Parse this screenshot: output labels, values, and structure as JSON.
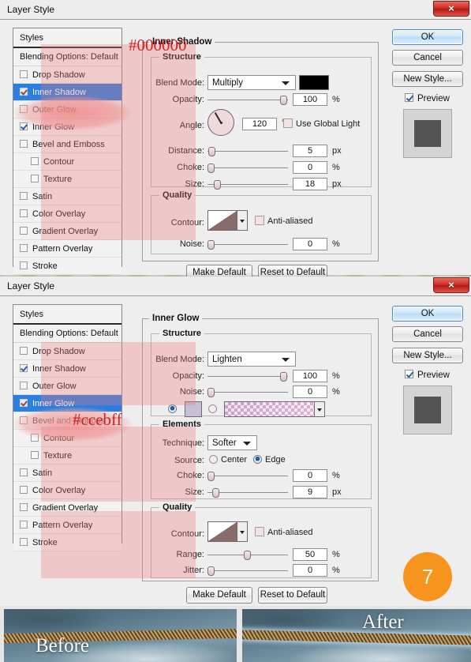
{
  "background": {
    "color": "#c3cdb4"
  },
  "dialogs": [
    {
      "title": "Layer Style",
      "close_label": "×",
      "styles_header": "Styles",
      "blending_options": "Blending Options: Default",
      "style_items": [
        {
          "label": "Drop Shadow",
          "checked": false,
          "indent": false,
          "selected": false
        },
        {
          "label": "Inner Shadow",
          "checked": true,
          "indent": false,
          "selected": true
        },
        {
          "label": "Outer Glow",
          "checked": false,
          "indent": false,
          "selected": false
        },
        {
          "label": "Inner Glow",
          "checked": true,
          "indent": false,
          "selected": false
        },
        {
          "label": "Bevel and Emboss",
          "checked": false,
          "indent": false,
          "selected": false
        },
        {
          "label": "Contour",
          "checked": false,
          "indent": true,
          "selected": false
        },
        {
          "label": "Texture",
          "checked": false,
          "indent": true,
          "selected": false
        },
        {
          "label": "Satin",
          "checked": false,
          "indent": false,
          "selected": false
        },
        {
          "label": "Color Overlay",
          "checked": false,
          "indent": false,
          "selected": false
        },
        {
          "label": "Gradient Overlay",
          "checked": false,
          "indent": false,
          "selected": false
        },
        {
          "label": "Pattern Overlay",
          "checked": false,
          "indent": false,
          "selected": false
        },
        {
          "label": "Stroke",
          "checked": false,
          "indent": false,
          "selected": false
        }
      ],
      "panel_title": "Inner Shadow",
      "structure_label": "Structure",
      "quality_label": "Quality",
      "annotation": "#000000",
      "fields": {
        "blend_mode_label": "Blend Mode:",
        "blend_mode_value": "Multiply",
        "color_swatch": "#000000",
        "opacity_label": "Opacity:",
        "opacity_value": "100",
        "opacity_unit": "%",
        "angle_label": "Angle:",
        "angle_value": "120",
        "angle_unit": "°",
        "use_global_light": "Use Global Light",
        "use_global_light_checked": false,
        "distance_label": "Distance:",
        "distance_value": "5",
        "distance_unit": "px",
        "choke_label": "Choke:",
        "choke_value": "0",
        "choke_unit": "%",
        "size_label": "Size:",
        "size_value": "18",
        "size_unit": "px",
        "contour_label": "Contour:",
        "anti_aliased": "Anti-aliased",
        "anti_aliased_checked": false,
        "noise_label": "Noise:",
        "noise_value": "0",
        "noise_unit": "%"
      },
      "buttons": {
        "ok": "OK",
        "cancel": "Cancel",
        "new_style": "New Style...",
        "preview": "Preview",
        "preview_checked": true,
        "make_default": "Make Default",
        "reset_to_default": "Reset to Default"
      }
    },
    {
      "title": "Layer Style",
      "close_label": "×",
      "styles_header": "Styles",
      "blending_options": "Blending Options: Default",
      "style_items": [
        {
          "label": "Drop Shadow",
          "checked": false,
          "indent": false,
          "selected": false
        },
        {
          "label": "Inner Shadow",
          "checked": true,
          "indent": false,
          "selected": false
        },
        {
          "label": "Outer Glow",
          "checked": false,
          "indent": false,
          "selected": false
        },
        {
          "label": "Inner Glow",
          "checked": true,
          "indent": false,
          "selected": true
        },
        {
          "label": "Bevel and Emboss",
          "checked": false,
          "indent": false,
          "selected": false
        },
        {
          "label": "Contour",
          "checked": false,
          "indent": true,
          "selected": false
        },
        {
          "label": "Texture",
          "checked": false,
          "indent": true,
          "selected": false
        },
        {
          "label": "Satin",
          "checked": false,
          "indent": false,
          "selected": false
        },
        {
          "label": "Color Overlay",
          "checked": false,
          "indent": false,
          "selected": false
        },
        {
          "label": "Gradient Overlay",
          "checked": false,
          "indent": false,
          "selected": false
        },
        {
          "label": "Pattern Overlay",
          "checked": false,
          "indent": false,
          "selected": false
        },
        {
          "label": "Stroke",
          "checked": false,
          "indent": false,
          "selected": false
        }
      ],
      "panel_title": "Inner Glow",
      "structure_label": "Structure",
      "elements_label": "Elements",
      "quality_label": "Quality",
      "annotation": "#ccebff",
      "fields": {
        "blend_mode_label": "Blend Mode:",
        "blend_mode_value": "Lighten",
        "opacity_label": "Opacity:",
        "opacity_value": "100",
        "opacity_unit": "%",
        "noise_label": "Noise:",
        "noise_value": "0",
        "noise_unit": "%",
        "color_swatch": "#ccebff",
        "technique_label": "Technique:",
        "technique_value": "Softer",
        "source_label": "Source:",
        "source_center": "Center",
        "source_edge": "Edge",
        "source_selected": "Edge",
        "choke_label": "Choke:",
        "choke_value": "0",
        "choke_unit": "%",
        "size_label": "Size:",
        "size_value": "9",
        "size_unit": "px",
        "contour_label": "Contour:",
        "anti_aliased": "Anti-aliased",
        "anti_aliased_checked": false,
        "range_label": "Range:",
        "range_value": "50",
        "range_unit": "%",
        "jitter_label": "Jitter:",
        "jitter_value": "0",
        "jitter_unit": "%"
      },
      "buttons": {
        "ok": "OK",
        "cancel": "Cancel",
        "new_style": "New Style...",
        "preview": "Preview",
        "preview_checked": true,
        "make_default": "Make Default",
        "reset_to_default": "Reset to Default"
      }
    }
  ],
  "step_badge": {
    "number": "7",
    "color": "#f7941e"
  },
  "comparison": {
    "before_label": "Before",
    "after_label": "After"
  }
}
